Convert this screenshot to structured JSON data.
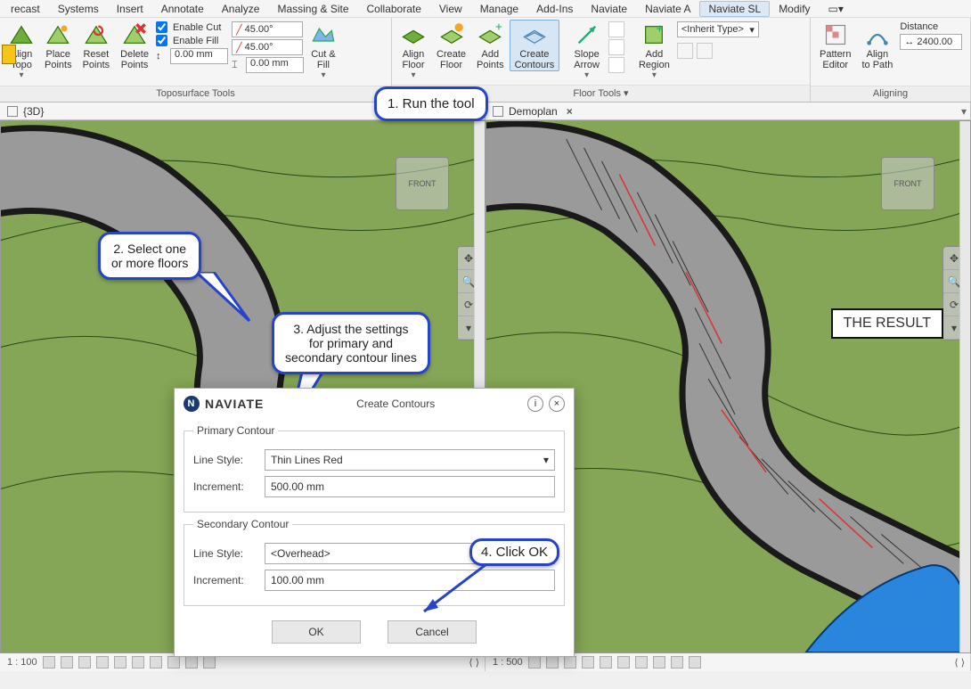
{
  "menu": {
    "items": [
      "recast",
      "Systems",
      "Insert",
      "Annotate",
      "Analyze",
      "Massing & Site",
      "Collaborate",
      "View",
      "Manage",
      "Add-Ins",
      "Naviate",
      "Naviate A",
      "Naviate SL",
      "Modify"
    ],
    "active_index": 12
  },
  "ribbon": {
    "toposurface": {
      "label": "Toposurface Tools",
      "align_topo": "Align\nTopo",
      "place_points": "Place\nPoints",
      "reset_points": "Reset\nPoints",
      "delete_points": "Delete\nPoints",
      "enable_cut": "Enable Cut",
      "enable_fill": "Enable Fill",
      "angle1": "45.00°",
      "angle2": "45.00°",
      "offset1": "0.00 mm",
      "offset2": "0.00 mm",
      "cut_fill": "Cut &\nFill"
    },
    "floor_tools": {
      "label": "Floor Tools ▾",
      "align_floor": "Align\nFloor",
      "create_floor": "Create\nFloor",
      "add_points": "Add\nPoints",
      "create_contours": "Create\nContours",
      "slope_arrow": "Slope\nArrow",
      "add_region": "Add\nRegion",
      "inherit": "<Inherit Type>"
    },
    "aligning": {
      "label": "Aligning",
      "pattern_editor": "Pattern\nEditor",
      "align_to_path": "Align\nto Path",
      "distance": "Distance",
      "distance_val": "2400.00"
    }
  },
  "views": {
    "left_tab": "{3D}",
    "right_tab": "Demoplan"
  },
  "callouts": {
    "c1": "1. Run the tool",
    "c2": "2. Select one\nor more floors",
    "c3": "3. Adjust the settings\nfor primary and\nsecondary contour lines",
    "c4": "4. Click OK",
    "result": "THE RESULT"
  },
  "dialog": {
    "brand": "NAVIATE",
    "title": "Create Contours",
    "primary_legend": "Primary Contour",
    "secondary_legend": "Secondary Contour",
    "line_style_label": "Line Style:",
    "increment_label": "Increment:",
    "primary_style": "Thin Lines Red",
    "primary_inc": "500.00 mm",
    "secondary_style": "<Overhead>",
    "secondary_inc": "100.00 mm",
    "ok": "OK",
    "cancel": "Cancel"
  },
  "status": {
    "left_scale": "1 : 100",
    "right_scale": "1 : 500"
  },
  "viewcube": "FRONT"
}
